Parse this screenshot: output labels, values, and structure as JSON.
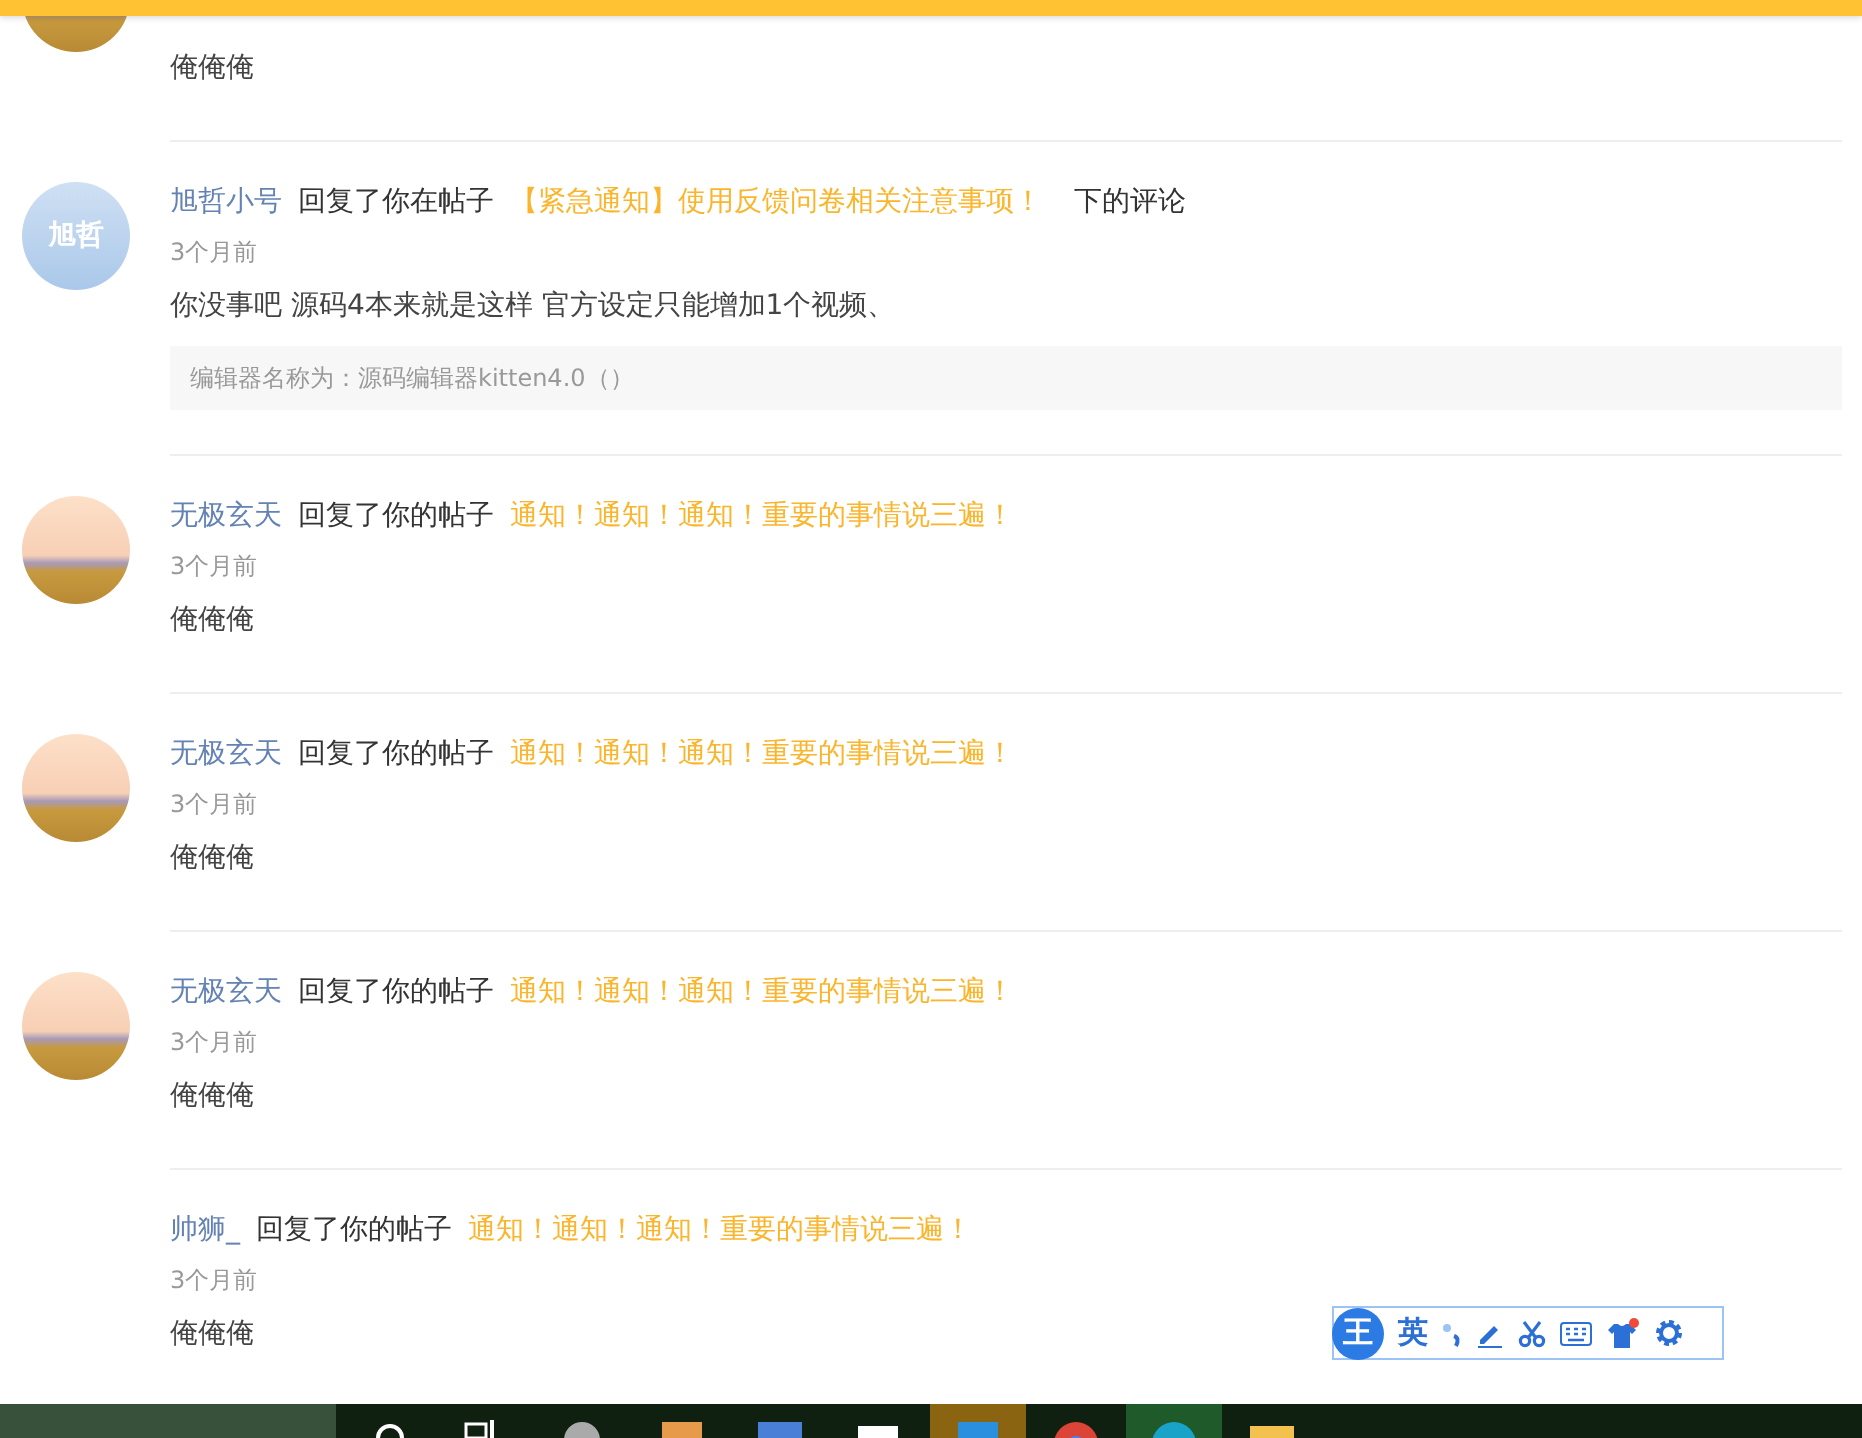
{
  "notifications": [
    {
      "avatar": {
        "kind": "cartoon"
      },
      "content": "俺俺俺"
    },
    {
      "avatar": {
        "kind": "initials",
        "text": "旭哲"
      },
      "user": "旭哲小号",
      "action": "回复了你在帖子",
      "post": "【紧急通知】使用反馈问卷相关注意事项！",
      "suffix": "下的评论",
      "time": "3个月前",
      "content": "你没事吧 源码4本来就是这样 官方设定只能增加1个视频、",
      "quote": "编辑器名称为：源码编辑器kitten4.0（）"
    },
    {
      "avatar": {
        "kind": "cartoon"
      },
      "user": "无极玄天",
      "action": "回复了你的帖子",
      "post": "通知！通知！通知！重要的事情说三遍！",
      "time": "3个月前",
      "content": "俺俺俺"
    },
    {
      "avatar": {
        "kind": "cartoon"
      },
      "user": "无极玄天",
      "action": "回复了你的帖子",
      "post": "通知！通知！通知！重要的事情说三遍！",
      "time": "3个月前",
      "content": "俺俺俺"
    },
    {
      "avatar": {
        "kind": "cartoon"
      },
      "user": "无极玄天",
      "action": "回复了你的帖子",
      "post": "通知！通知！通知！重要的事情说三遍！",
      "time": "3个月前",
      "content": "俺俺俺"
    },
    {
      "avatar": {
        "kind": "none"
      },
      "user": "帅狮_",
      "action": "回复了你的帖子",
      "post": "通知！通知！通知！重要的事情说三遍！",
      "time": "3个月前",
      "content": "俺俺俺"
    }
  ],
  "ime_toolbar": {
    "logo": "王",
    "mode": "英"
  }
}
